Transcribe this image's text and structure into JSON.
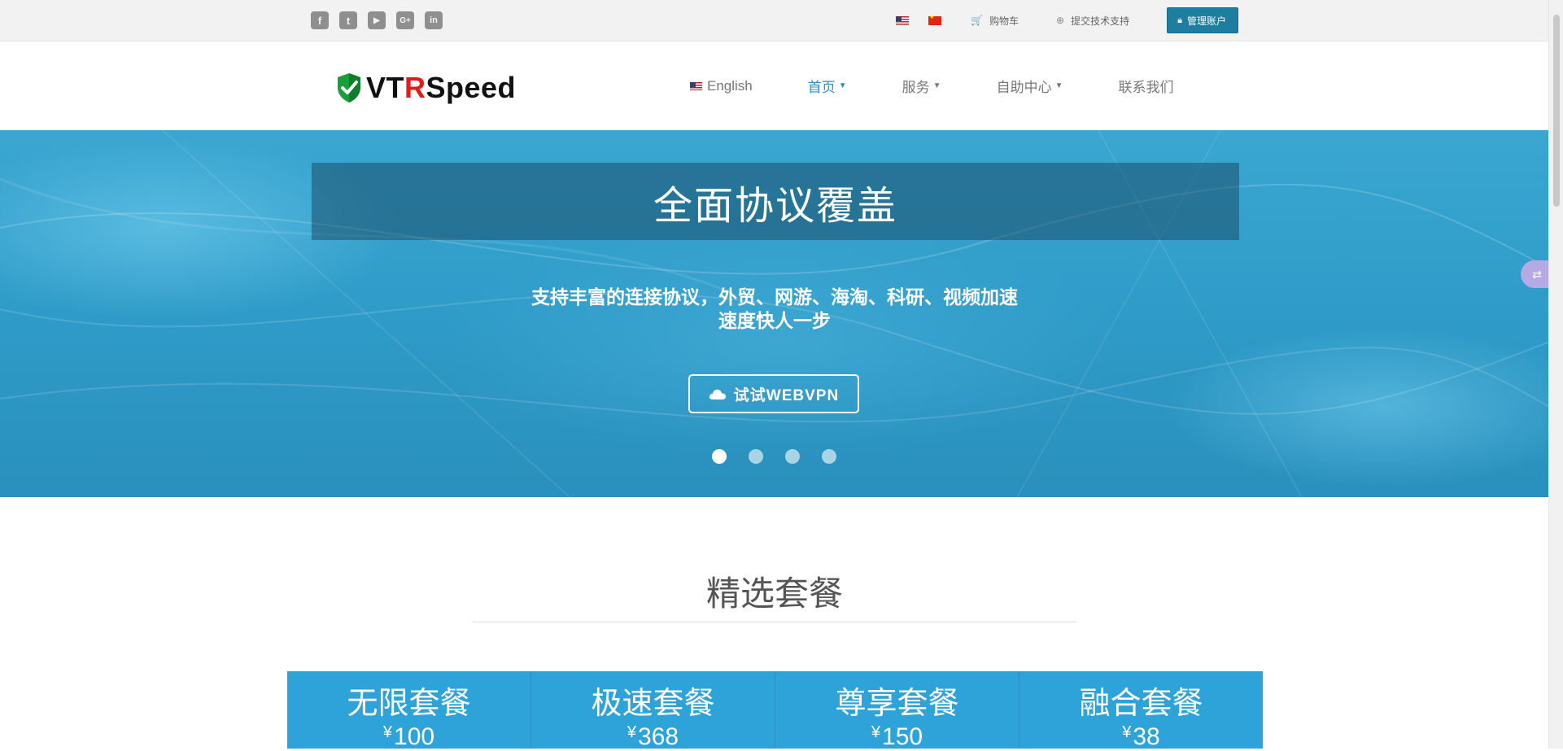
{
  "topbar": {
    "social": [
      {
        "name": "facebook-icon",
        "glyph": "f"
      },
      {
        "name": "twitter-icon",
        "glyph": "t"
      },
      {
        "name": "youtube-icon",
        "glyph": "▶"
      },
      {
        "name": "google-plus-icon",
        "glyph": "G+"
      },
      {
        "name": "linkedin-icon",
        "glyph": "in"
      }
    ],
    "cart_label": "购物车",
    "support_label": "提交技术支持",
    "account_label": "管理账户"
  },
  "header": {
    "logo": {
      "part1": "VT",
      "part2": "R",
      "part3": "Speed"
    },
    "nav": {
      "english": "English",
      "home": "首页",
      "services": "服务",
      "self_service": "自助中心",
      "contact": "联系我们"
    }
  },
  "hero": {
    "title": "全面协议覆盖",
    "subtitle_line1": "支持丰富的连接协议，外贸、网游、海淘、科研、视频加速",
    "subtitle_line2": "速度快人一步",
    "button_label": "试试WEBVPN",
    "slides": 4,
    "active_slide": 1
  },
  "featured": {
    "title": "精选套餐",
    "plans": [
      {
        "name": "无限套餐",
        "currency": "¥",
        "price": "100"
      },
      {
        "name": "极速套餐",
        "currency": "¥",
        "price": "368"
      },
      {
        "name": "尊享套餐",
        "currency": "¥",
        "price": "150"
      },
      {
        "name": "融合套餐",
        "currency": "¥",
        "price": "38"
      }
    ]
  },
  "colors": {
    "accent": "#2c8fc4",
    "account_button": "#1f7ea0",
    "plan_bg": "#2ea3d9",
    "hero_bg": "#2f9bc8",
    "logo_red": "#e21b1b",
    "shield_green": "#1a9e3a"
  }
}
